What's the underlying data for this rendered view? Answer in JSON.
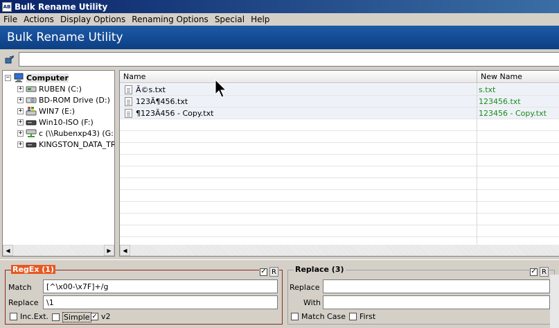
{
  "window": {
    "title": "Bulk Rename Utility"
  },
  "menu": [
    "File",
    "Actions",
    "Display Options",
    "Renaming Options",
    "Special",
    "Help"
  ],
  "banner": {
    "title": "Bulk Rename Utility"
  },
  "path": {
    "value": ""
  },
  "tree": {
    "root": "Computer",
    "items": [
      {
        "label": "RUBEN (C:)",
        "icon": "hard-drive-icon"
      },
      {
        "label": "BD-ROM Drive (D:)",
        "icon": "optical-drive-icon"
      },
      {
        "label": "WIN7 (E:)",
        "icon": "windows-drive-icon"
      },
      {
        "label": "Win10-ISO (F:)",
        "icon": "usb-drive-icon"
      },
      {
        "label": "c (\\\\Rubenxp43) (G:)",
        "icon": "network-drive-icon"
      },
      {
        "label": "KINGSTON_DATA_TR...",
        "icon": "usb-drive-icon"
      }
    ]
  },
  "file_list": {
    "columns": {
      "name": "Name",
      "new_name": "New Name"
    },
    "rows": [
      {
        "name": "Ã©s.txt",
        "new_name": "s.txt"
      },
      {
        "name": "123Ã¶456.txt",
        "new_name": "123456.txt"
      },
      {
        "name": "¶123Ã456 - Copy.txt",
        "new_name": "123456 - Copy.txt"
      }
    ]
  },
  "regex_group": {
    "title": "RegEx (1)",
    "enabled": true,
    "r_label": "R",
    "match_label": "Match",
    "match_value": "[^\\x00-\\x7F]+/g",
    "replace_label": "Replace",
    "replace_value": "\\1",
    "options": [
      {
        "label": "Inc.Ext.",
        "checked": false
      },
      {
        "label": "Simple",
        "checked": false
      },
      {
        "label": "v2",
        "checked": true
      }
    ]
  },
  "replace_group": {
    "title": "Replace (3)",
    "enabled": true,
    "r_label": "R",
    "replace_label": "Replace",
    "replace_value": "",
    "with_label": "With",
    "with_value": "",
    "options": [
      {
        "label": "Match Case",
        "checked": false
      },
      {
        "label": "First",
        "checked": false
      }
    ]
  },
  "colors": {
    "accent_orange": "#e85820",
    "new_name_green": "#1a8a1a",
    "banner_blue": "#1d5aa8"
  }
}
